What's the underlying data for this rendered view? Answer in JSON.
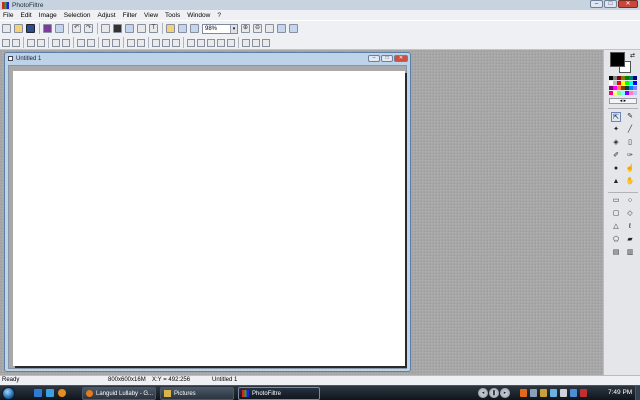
{
  "app": {
    "title": "PhotoFiltre"
  },
  "menu": [
    "File",
    "Edit",
    "Image",
    "Selection",
    "Adjust",
    "Filter",
    "View",
    "Tools",
    "Window",
    "?"
  ],
  "toolbar": {
    "zoom": "98%"
  },
  "document": {
    "title": "Untitled 1"
  },
  "status": {
    "state": "Ready",
    "image_info": "800x600x16M",
    "cursor": "X:Y = 492:256",
    "doc_name": "Untitled 1"
  },
  "taskbar": {
    "tasks": [
      "Languid Lullaby - G...",
      "Pictures",
      "PhotoFiltre"
    ],
    "clock": "7:49 PM"
  },
  "palette_colors": [
    "#000000",
    "#808080",
    "#800000",
    "#808000",
    "#008000",
    "#008080",
    "#000080",
    "#ffffff",
    "#c0c0c0",
    "#ff0000",
    "#ffff00",
    "#00ff00",
    "#00ffff",
    "#0000ff",
    "#800080",
    "#ff00ff",
    "#ff8040",
    "#804000",
    "#004040",
    "#0080ff",
    "#8080ff",
    "#ff0080",
    "#ffff80",
    "#80ff80",
    "#80ffff",
    "#8000ff",
    "#ff80c0",
    "#c0c0ff"
  ],
  "colors": {
    "foreground": "#000000",
    "background": "#ffffff"
  }
}
